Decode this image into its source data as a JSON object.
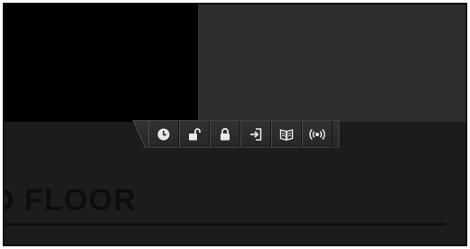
{
  "floor": {
    "label": "D FLOOR"
  },
  "toolbar": {
    "buttons": [
      {
        "name": "clock-button",
        "icon": "clock-icon"
      },
      {
        "name": "unlock-button",
        "icon": "unlock-icon"
      },
      {
        "name": "lock-button",
        "icon": "lock-icon"
      },
      {
        "name": "enter-button",
        "icon": "enter-icon"
      },
      {
        "name": "book-button",
        "icon": "book-icon"
      },
      {
        "name": "broadcast-button",
        "icon": "broadcast-icon"
      }
    ]
  },
  "colors": {
    "frame_bg": "#1e1e1e",
    "top_left": "#000000",
    "top_right": "#2e2e2e",
    "icon": "#e8e8e8"
  }
}
